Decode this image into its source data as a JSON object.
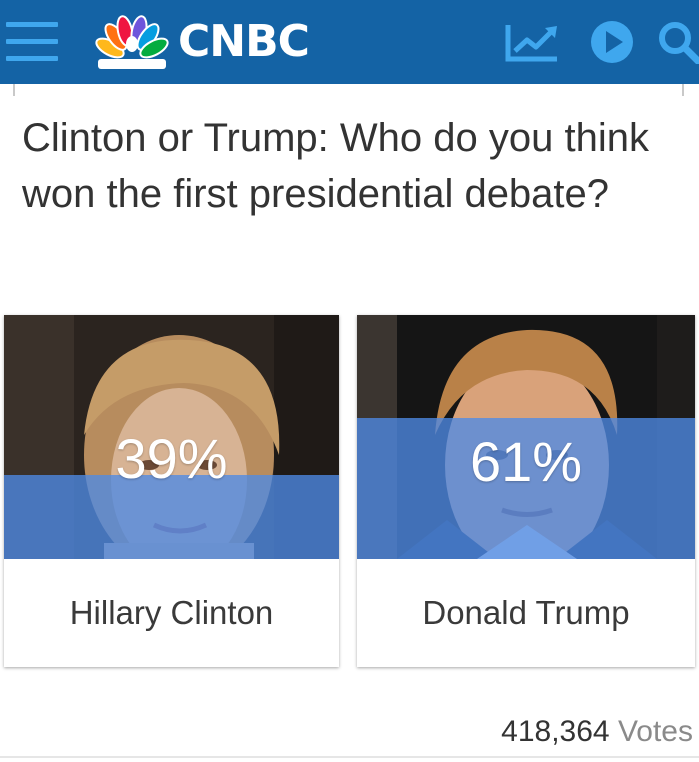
{
  "header": {
    "brand_name": "CNBC",
    "menu_icon": "hamburger-menu-icon",
    "logo_icon": "peacock-logo-icon",
    "actions": [
      "markets-chart-icon",
      "video-play-icon",
      "search-icon"
    ],
    "background_color": "#1463a5",
    "icon_color": "#3fa7ee"
  },
  "poll": {
    "question": "Clinton or Trump: Who do you think won the first presidential debate?",
    "options": [
      {
        "name": "Hillary Clinton",
        "percent_label": "39%",
        "percent": 39
      },
      {
        "name": "Donald Trump",
        "percent_label": "61%",
        "percent": 61
      }
    ],
    "votes_count": "418,364",
    "votes_label": "Votes",
    "bar_color": "#4e8be6"
  }
}
